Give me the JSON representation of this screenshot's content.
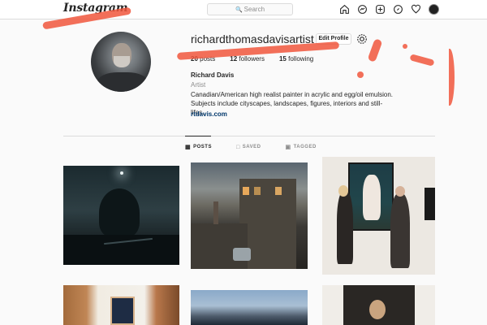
{
  "header": {
    "logo_text": "Instagram",
    "search_placeholder": "Search",
    "icons": [
      "home-icon",
      "messenger-icon",
      "new-post-icon",
      "explore-icon",
      "activity-heart-icon",
      "profile-avatar-icon"
    ]
  },
  "profile": {
    "username": "richardthomasdavisartist",
    "edit_profile_label": "Edit Profile",
    "stats": {
      "posts_count": "20",
      "posts_label": "posts",
      "followers_count": "12",
      "followers_label": "followers",
      "following_count": "15",
      "following_label": "following"
    },
    "full_name": "Richard Davis",
    "category": "Artist",
    "bio": "Canadian/American high realist painter in acrylic and egg/oil emulsion. Subjects include cityscapes, landscapes, figures, interiors and still-lifes.",
    "website": "rtdavis.com"
  },
  "tabs": [
    {
      "label": "POSTS",
      "active": true,
      "icon": "grid-icon"
    },
    {
      "label": "SAVED",
      "active": false,
      "icon": "bookmark-icon"
    },
    {
      "label": "TAGGED",
      "active": false,
      "icon": "tag-icon"
    }
  ],
  "colors": {
    "accent_brush": "#f0563c",
    "link": "#00376b",
    "border": "#dbdbdb",
    "background": "#fafafa"
  }
}
